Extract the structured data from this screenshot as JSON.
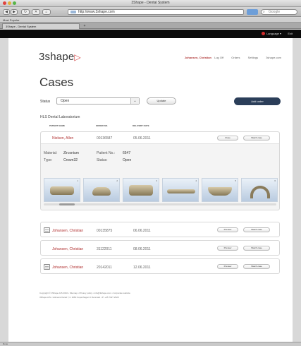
{
  "browser": {
    "window_title": "3Shape - Dental System",
    "url": "http://www.3shape.com",
    "search_placeholder": "Google",
    "bookmarks_label": "Most Popular",
    "tab_label": "3Shape - Dental System",
    "tab_add": "+",
    "nav_back": "◀",
    "nav_forward": "▶",
    "nav_reload": "↻",
    "nav_stop": "✕",
    "nav_home": "⌂",
    "status_text": "Done"
  },
  "app": {
    "language_label": "Language ▾",
    "exit_label": "Exit",
    "logo_text": "3shape",
    "logo_mark": "▷",
    "user_name": "Johansen, Christian",
    "nav": [
      "Log Off",
      "Orders",
      "Settings",
      "3shape.com"
    ]
  },
  "page": {
    "title": "Cases",
    "status_label": "Status",
    "status_value": "Open",
    "status_arrow": "⌄",
    "update_label": "Update",
    "add_order_label": "Add order",
    "lab_name": "HLS Dental Laboratorium",
    "columns": [
      "PATIENT NAME",
      "ORDER NO.",
      "DELIVERY DATE"
    ]
  },
  "expanded_case": {
    "patient": "Nielsen, Allen",
    "order_no": "00136587",
    "delivery_date": "05.06.2011",
    "buttons": [
      "Close",
      "Watch case"
    ],
    "material_label": "Material:",
    "material_value": "Zirconium",
    "type_label": "Type:",
    "type_value": "Crown32",
    "patient_no_label": "Patient No.:",
    "patient_no_value": "6547",
    "status_label": "Status:",
    "status_value": "Open",
    "thumbnails": [
      "1",
      "2",
      "3",
      "4",
      "5",
      "6"
    ],
    "scroll_position": 0.07
  },
  "cases": [
    {
      "patient": "Johansen, Christian",
      "order_no": "00135875",
      "delivery_date": "06.06.2011",
      "buttons": [
        "Preview",
        "Watch case"
      ],
      "has_doc": true
    },
    {
      "patient": "Johansen, Christian",
      "order_no": "31122011",
      "delivery_date": "08.06.2011",
      "buttons": [
        "Preview",
        "Watch case"
      ],
      "has_doc": false
    },
    {
      "patient": "Johansen, Christian",
      "order_no": "20142011",
      "delivery_date": "12.06.2011",
      "buttons": [
        "Preview",
        "Watch case"
      ],
      "has_doc": true
    }
  ],
  "footer": {
    "line1": "Copyright © 3Shape A/S 2010 • Sitemap • Privacy policy • info@3shape.com • Corporate website",
    "line2": "3Shape A/S • Holmens Kanal 7,4. 1060 Copenhagen K Denmark • P: +45 7027 2620"
  },
  "colors": {
    "accent_dark": "#2b3e59",
    "patient_red": "#b03030",
    "black_bar": "#0b0b0b"
  }
}
